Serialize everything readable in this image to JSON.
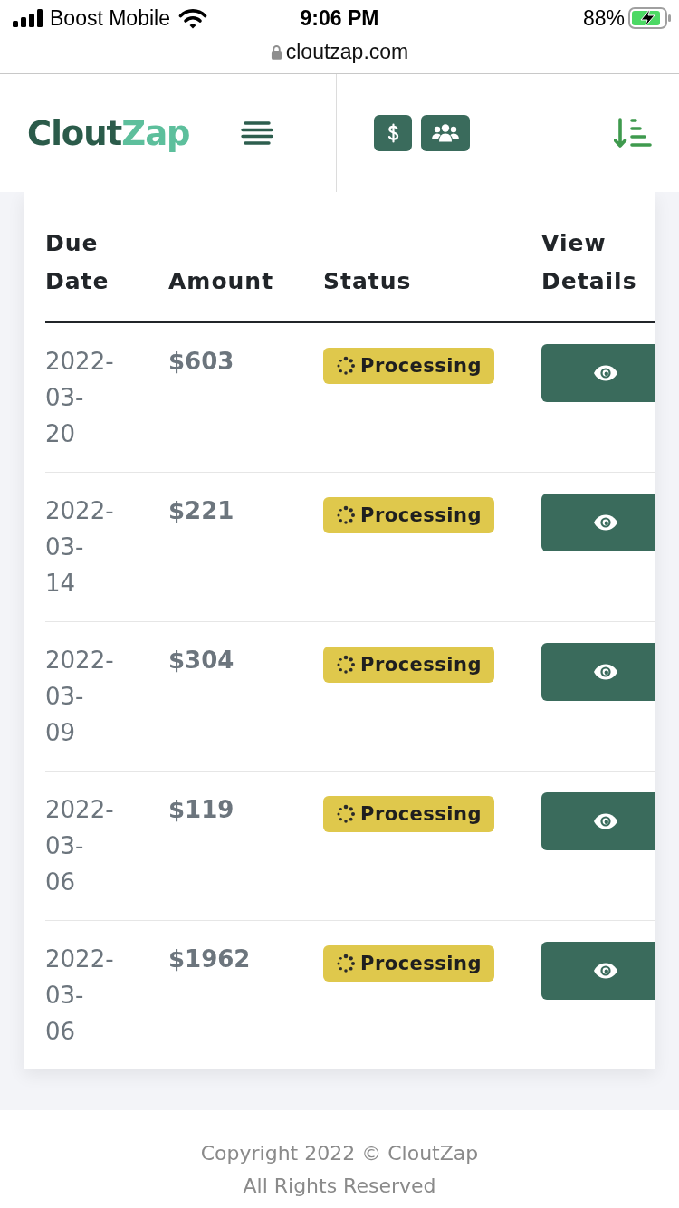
{
  "status_bar": {
    "carrier": "Boost Mobile",
    "time": "9:06 PM",
    "battery": "88%",
    "charging": true
  },
  "address_bar": {
    "url": "cloutzap.com"
  },
  "header": {
    "logo_main": "Clout",
    "logo_accent": "Zap"
  },
  "table": {
    "columns": [
      "Due Date",
      "Amount",
      "Status",
      "View Details"
    ],
    "rows": [
      {
        "due_date": "2022-03-20",
        "amount": "$603",
        "status": "Processing"
      },
      {
        "due_date": "2022-03-14",
        "amount": "$221",
        "status": "Processing"
      },
      {
        "due_date": "2022-03-09",
        "amount": "$304",
        "status": "Processing"
      },
      {
        "due_date": "2022-03-06",
        "amount": "$119",
        "status": "Processing"
      },
      {
        "due_date": "2022-03-06",
        "amount": "$1962",
        "status": "Processing"
      }
    ]
  },
  "footer": {
    "copyright": "Copyright 2022 © CloutZap",
    "rights": "All Rights Reserved"
  }
}
